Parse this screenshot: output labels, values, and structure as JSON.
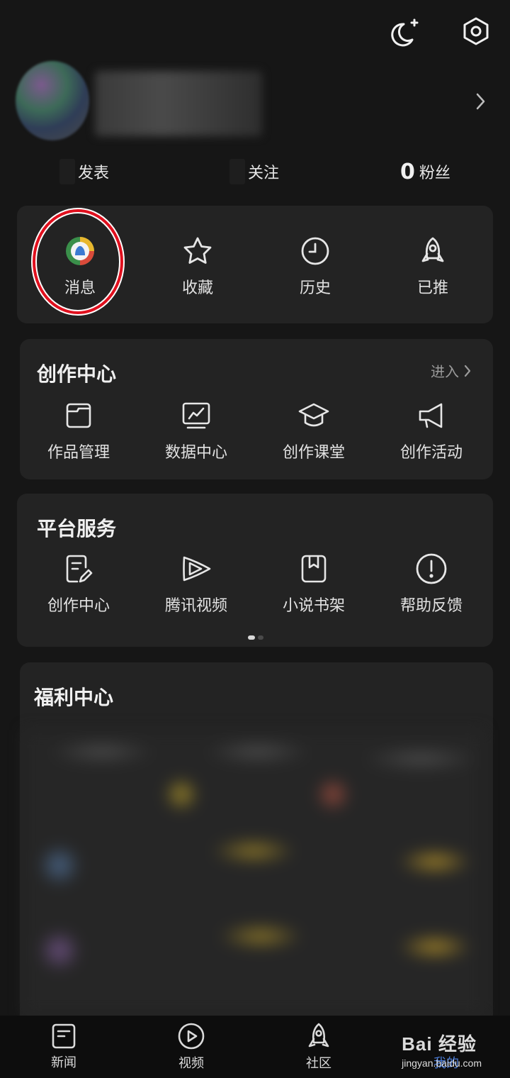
{
  "top_bar": {
    "night_mode_icon": "moon-sparkle-icon",
    "settings_icon": "settings-hexagon-icon"
  },
  "profile": {
    "chevron_icon": "chevron-right-icon",
    "stats": [
      {
        "count": "",
        "label": "发表"
      },
      {
        "count": "",
        "label": "关注"
      },
      {
        "count": "0",
        "label": "粉丝"
      }
    ]
  },
  "quick_actions": [
    {
      "label": "消息",
      "icon": "tencent-news-logo-icon"
    },
    {
      "label": "收藏",
      "icon": "star-icon"
    },
    {
      "label": "历史",
      "icon": "clock-icon"
    },
    {
      "label": "已推",
      "icon": "rocket-icon"
    }
  ],
  "creation_center": {
    "title": "创作中心",
    "enter_label": "进入",
    "items": [
      {
        "label": "作品管理",
        "icon": "folder-icon"
      },
      {
        "label": "数据中心",
        "icon": "trend-chart-icon"
      },
      {
        "label": "创作课堂",
        "icon": "graduation-cap-icon"
      },
      {
        "label": "创作活动",
        "icon": "megaphone-icon"
      }
    ]
  },
  "platform_services": {
    "title": "平台服务",
    "items": [
      {
        "label": "创作中心",
        "icon": "edit-document-icon"
      },
      {
        "label": "腾讯视频",
        "icon": "tencent-video-icon"
      },
      {
        "label": "小说书架",
        "icon": "bookmark-book-icon"
      },
      {
        "label": "帮助反馈",
        "icon": "exclamation-circle-icon"
      }
    ]
  },
  "welfare_center": {
    "title": "福利中心"
  },
  "bottom_nav": [
    {
      "label": "新闻",
      "icon": "news-doc-icon"
    },
    {
      "label": "视频",
      "icon": "play-circle-icon"
    },
    {
      "label": "社区",
      "icon": "rocket-icon"
    },
    {
      "label": "我的",
      "icon": "profile-icon"
    }
  ],
  "watermark": {
    "line1": "Bai 经验",
    "line2": "jingyan.baidu.com"
  },
  "colors": {
    "background": "#161616",
    "card": "#232323",
    "highlight_ring": "#e0101e",
    "active_nav": "#4a7bd6"
  }
}
